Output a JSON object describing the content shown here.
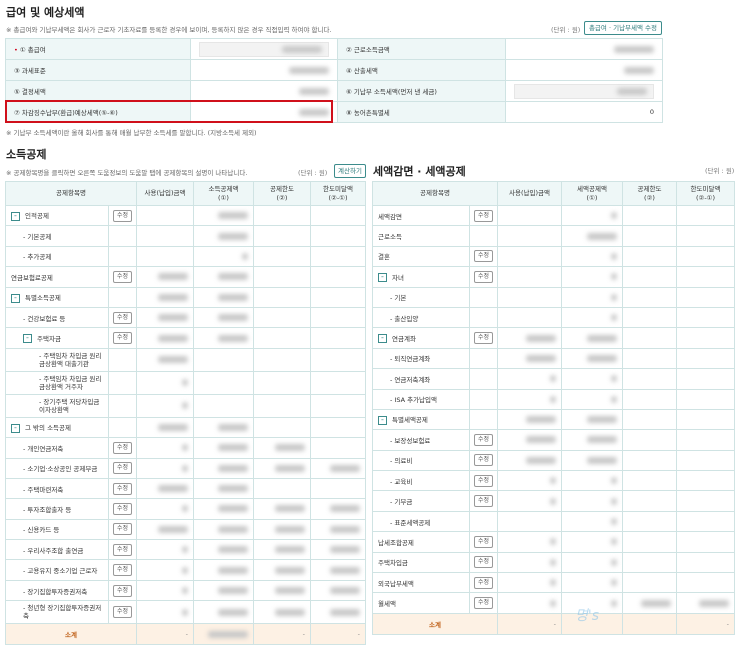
{
  "salary": {
    "title": "급여 및 예상세액",
    "notice": "※ 총급여와 기납부세액은 회사가 근로자 기초자료를 등록한 경우에 보이며, 등록하지 않은 경우 직접입력 하여야 합니다.",
    "unit": "(단위 : 원)",
    "edit_button": "총급여 · 기납부세액 수정",
    "rows": [
      {
        "l": "① 총급여",
        "lreq": true,
        "r": "② 근로소득금액",
        "rv": ""
      },
      {
        "l": "③ 과세표준",
        "r": "④ 산출세액",
        "rv": ""
      },
      {
        "l": "⑤ 결정세액",
        "r": "⑥ 기납부 소득세액(먼저 낸 세금)",
        "rv": ""
      },
      {
        "l": "⑦ 차감징수납부(환급)예상세액(⑤-⑥)",
        "r": "⑧ 농어촌특별세",
        "rv": "0"
      }
    ],
    "footnote": "※ 기납부 소득세액이란 올해 회사를 통해 매월 납부한 소득세를 말합니다. (지방소득세 제외)",
    "highlight_color": "#d0101b"
  },
  "income": {
    "title": "소득공제",
    "notice": "※ 공제항목명을 클릭하면 오른쪽 도움정보의 도움말 탭에 공제항목의 설명이 나타납니다.",
    "unit": "(단위 : 원)",
    "calc_button": "계산하기",
    "headers": [
      "공제항목명",
      "사용(납입)금액",
      "소득공제액\n(①)",
      "공제한도\n(②)",
      "한도미달액\n(②-①)"
    ],
    "edit_label": "수정",
    "rows": [
      {
        "name": "인적공제",
        "lvl": 0,
        "tog": true,
        "edit": true
      },
      {
        "name": "- 기본공제",
        "lvl": 1
      },
      {
        "name": "- 추가공제",
        "lvl": 1
      },
      {
        "name": "연금보험료공제",
        "lvl": 0,
        "edit": true
      },
      {
        "name": "특별소득공제",
        "lvl": 0,
        "tog": true
      },
      {
        "name": "- 건강보험료 등",
        "lvl": 1,
        "edit": true
      },
      {
        "name": "주택자금",
        "lvl": 1,
        "tog": true,
        "edit": true
      },
      {
        "name": "- 주택임차 차입금 원리금상환액 대출기관",
        "lvl": 2,
        "tall": true
      },
      {
        "name": "- 주택임차 차입금 원리금상환액 거주자",
        "lvl": 2,
        "tall": true
      },
      {
        "name": "- 장기주택 저당차입금 이자상환액",
        "lvl": 2,
        "tall": true
      },
      {
        "name": "그 밖의 소득공제",
        "lvl": 0,
        "tog": true
      },
      {
        "name": "- 개인연금저축",
        "lvl": 1,
        "edit": true
      },
      {
        "name": "- 소기업·소상공인 공제부금",
        "lvl": 1,
        "edit": true
      },
      {
        "name": "- 주택마련저축",
        "lvl": 1,
        "edit": true
      },
      {
        "name": "- 투자조합출자 등",
        "lvl": 1,
        "edit": true
      },
      {
        "name": "- 신용카드 등",
        "lvl": 1,
        "edit": true
      },
      {
        "name": "- 우리사주조합 출연금",
        "lvl": 1,
        "edit": true
      },
      {
        "name": "- 고용유지 중소기업 근로자",
        "lvl": 1,
        "edit": true
      },
      {
        "name": "- 장기집합투자증권저축",
        "lvl": 1,
        "edit": true
      },
      {
        "name": "- 청년형 장기집합투자증권저축",
        "lvl": 1,
        "edit": true,
        "tall": true
      }
    ],
    "subtotal": {
      "label": "소계",
      "values": [
        "-",
        "",
        "-",
        "-"
      ]
    }
  },
  "tax": {
    "title": "세액감면 · 세액공제",
    "unit": "(단위 : 원)",
    "headers": [
      "공제항목명",
      "사용(납입)금액",
      "세액공제액\n(①)",
      "공제한도\n(②)",
      "한도미달액\n(②-①)"
    ],
    "rows": [
      {
        "name": "세액감면",
        "lvl": 0,
        "edit": true
      },
      {
        "name": "근로소득",
        "lvl": 0
      },
      {
        "name": "결혼",
        "lvl": 0,
        "edit": true
      },
      {
        "name": "자녀",
        "lvl": 0,
        "tog": true,
        "edit": true
      },
      {
        "name": "- 기본",
        "lvl": 1
      },
      {
        "name": "- 출산입양",
        "lvl": 1
      },
      {
        "name": "연금계좌",
        "lvl": 0,
        "tog": true,
        "edit": true
      },
      {
        "name": "- 퇴직연금계좌",
        "lvl": 1
      },
      {
        "name": "- 연금저축계좌",
        "lvl": 1
      },
      {
        "name": "- ISA 추가납입액",
        "lvl": 1
      },
      {
        "name": "특별세액공제",
        "lvl": 0,
        "tog": true
      },
      {
        "name": "- 보장성보험료",
        "lvl": 1,
        "edit": true
      },
      {
        "name": "- 의료비",
        "lvl": 1,
        "edit": true
      },
      {
        "name": "- 교육비",
        "lvl": 1,
        "edit": true
      },
      {
        "name": "- 기부금",
        "lvl": 1,
        "edit": true
      },
      {
        "name": "- 표준세액공제",
        "lvl": 1
      },
      {
        "name": "납세조합공제",
        "lvl": 0,
        "edit": true
      },
      {
        "name": "주택차입금",
        "lvl": 0,
        "edit": true
      },
      {
        "name": "외국납부세액",
        "lvl": 0,
        "edit": true
      },
      {
        "name": "월세액",
        "lvl": 0,
        "edit": true
      }
    ],
    "subtotal": {
      "label": "소계",
      "values": [
        "-",
        "",
        "",
        "-"
      ]
    }
  },
  "watermark": "명's"
}
